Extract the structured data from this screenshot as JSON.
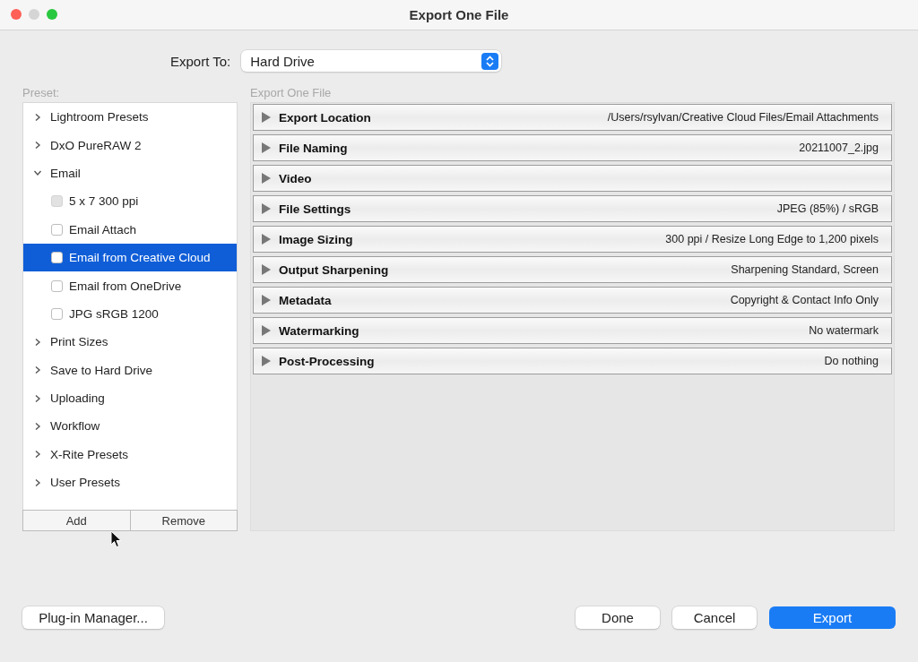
{
  "window": {
    "title": "Export One File"
  },
  "export_to": {
    "label": "Export To:",
    "value": "Hard Drive"
  },
  "preset": {
    "label": "Preset:",
    "items": [
      {
        "label": "Lightroom Presets",
        "expanded": false,
        "selected": false
      },
      {
        "label": "DxO PureRAW 2",
        "expanded": false,
        "selected": false
      },
      {
        "label": "Email",
        "expanded": true,
        "selected": false,
        "children": [
          {
            "label": "5 x 7 300 ppi",
            "selected": false,
            "disabled": true
          },
          {
            "label": "Email Attach",
            "selected": false,
            "disabled": false
          },
          {
            "label": "Email from Creative Cloud",
            "selected": true,
            "disabled": false
          },
          {
            "label": "Email from OneDrive",
            "selected": false,
            "disabled": false
          },
          {
            "label": "JPG sRGB 1200",
            "selected": false,
            "disabled": false
          }
        ]
      },
      {
        "label": "Print Sizes",
        "expanded": false,
        "selected": false
      },
      {
        "label": "Save to Hard Drive",
        "expanded": false,
        "selected": false
      },
      {
        "label": "Uploading",
        "expanded": false,
        "selected": false
      },
      {
        "label": "Workflow",
        "expanded": false,
        "selected": false
      },
      {
        "label": "X-Rite Presets",
        "expanded": false,
        "selected": false
      },
      {
        "label": "User Presets",
        "expanded": false,
        "selected": false
      }
    ],
    "buttons": [
      "Add",
      "Remove"
    ]
  },
  "export_panel": {
    "label": "Export One File",
    "sections": [
      {
        "title": "Export Location",
        "summary": "/Users/rsylvan/Creative Cloud Files/Email Attachments",
        "expanded": false
      },
      {
        "title": "File Naming",
        "summary": "20211007_2.jpg",
        "expanded": false
      },
      {
        "title": "Video",
        "expanded": false
      },
      {
        "title": "File Settings",
        "summary": "JPEG (85%) / sRGB",
        "expanded": false
      },
      {
        "title": "Image Sizing",
        "summary": "300 ppi / Resize Long Edge to 1,200 pixels",
        "expanded": false
      },
      {
        "title": "Output Sharpening",
        "summary": "Sharpening Standard, Screen",
        "expanded": false
      },
      {
        "title": "Metadata",
        "summary": "Copyright & Contact Info Only",
        "expanded": false
      },
      {
        "title": "Watermarking",
        "summary": "No watermark",
        "expanded": false
      },
      {
        "title": "Post-Processing",
        "summary": "Do nothing",
        "expanded": false
      }
    ]
  },
  "plugin_button": "Plug-in Manager...",
  "buttons": [
    {
      "label": "Done",
      "kind": "default"
    },
    {
      "label": "Cancel",
      "kind": "default"
    },
    {
      "label": "Export",
      "kind": "primary"
    }
  ]
}
